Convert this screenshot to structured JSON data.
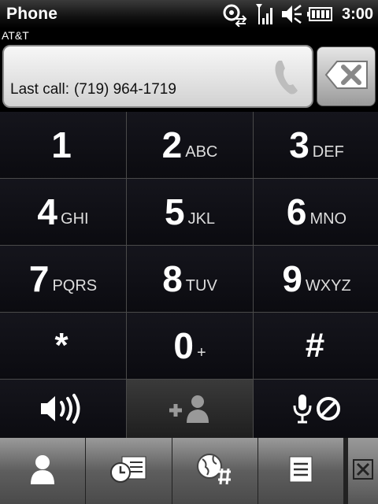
{
  "titlebar": {
    "title": "Phone",
    "clock": "3:00",
    "status_icons": [
      "connectivity-icon",
      "signal-strength-icon",
      "volume-muted-icon",
      "battery-icon"
    ]
  },
  "carrier": "AT&T",
  "dial_field": {
    "last_call_label": "Last call:",
    "last_call_number": "(719) 964-1719"
  },
  "keypad": {
    "keys": [
      {
        "digit": "1",
        "letters": ""
      },
      {
        "digit": "2",
        "letters": "ABC"
      },
      {
        "digit": "3",
        "letters": "DEF"
      },
      {
        "digit": "4",
        "letters": "GHI"
      },
      {
        "digit": "5",
        "letters": "JKL"
      },
      {
        "digit": "6",
        "letters": "MNO"
      },
      {
        "digit": "7",
        "letters": "PQRS"
      },
      {
        "digit": "8",
        "letters": "TUV"
      },
      {
        "digit": "9",
        "letters": "WXYZ"
      },
      {
        "digit": "*",
        "letters": ""
      },
      {
        "digit": "0",
        "letters": "+"
      },
      {
        "digit": "#",
        "letters": ""
      }
    ],
    "function_keys": [
      "speaker-icon",
      "add-contact-icon",
      "mute-microphone-icon"
    ]
  },
  "bottom_bar": [
    "contacts-icon",
    "call-history-icon",
    "speed-dial-icon",
    "menu-icon",
    "close-icon"
  ],
  "colors": {
    "key_background": "#0f0f15",
    "divider": "#4a4a4a",
    "field_background": "#e8e8e8"
  }
}
